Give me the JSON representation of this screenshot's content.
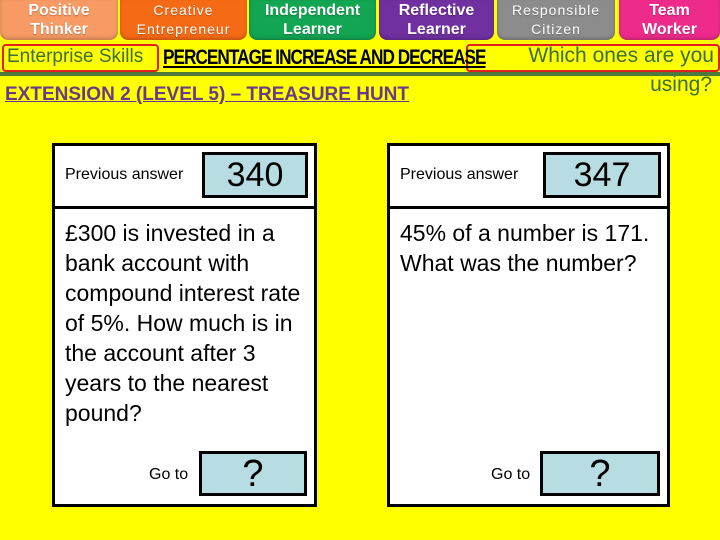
{
  "skills": [
    {
      "line1": "Positive",
      "line2": "Thinker",
      "color": "#f79a63"
    },
    {
      "line1": "Creative",
      "line2": "Entrepreneur",
      "color": "#f56a14"
    },
    {
      "line1": "Independent",
      "line2": "Learner",
      "color": "#12a552"
    },
    {
      "line1": "Reflective",
      "line2": "Learner",
      "color": "#7030a0"
    },
    {
      "line1": "Responsible",
      "line2": "Citizen",
      "color": "#8c8c8c"
    },
    {
      "line1": "Team",
      "line2": "Worker",
      "color": "#ee2b8b"
    }
  ],
  "header": {
    "enterprise_label": "Enterprise Skills",
    "topic_title": "PERCENTAGE  INCREASE AND DECREASE",
    "which_prompt": "Which ones are you",
    "which_prompt_2": "using?",
    "extension_title": "EXTENSION 2 (LEVEL 5) – TREASURE HUNT"
  },
  "cards": [
    {
      "previous_label": "Previous answer",
      "previous_answer": "340",
      "question": "£300 is invested in a bank account with compound interest rate of 5%. How much is in the account after 3 years to the nearest pound?",
      "goto_label": "Go to",
      "goto_value": "?"
    },
    {
      "previous_label": "Previous answer",
      "previous_answer": "347",
      "question": "45% of a number is 171. What was the number?",
      "goto_label": "Go to",
      "goto_value": "?"
    }
  ],
  "colors": {
    "background": "#ffff00",
    "answer_box": "#b7dde3",
    "highlight_border": "#e21f1f",
    "green_text": "#3c6e35",
    "extension_purple": "#6a3a8a"
  }
}
